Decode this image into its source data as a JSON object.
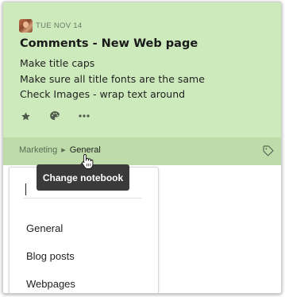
{
  "note": {
    "date": "TUE NOV 14",
    "title": "Comments - New Web page",
    "lines": [
      "Make title caps",
      "Make sure all title fonts are the same",
      "Check Images - wrap text around"
    ],
    "actions": [
      "star-icon",
      "palette-icon",
      "more-icon"
    ]
  },
  "footer": {
    "breadcrumb_parent": "Marketing",
    "breadcrumb_current": "General",
    "tag_icon": "tag-icon"
  },
  "tooltip": {
    "text": "Change notebook"
  },
  "notebook_picker": {
    "search_value": "",
    "items": [
      "General",
      "Blog posts",
      "Webpages"
    ]
  },
  "colors": {
    "card_bg": "#cdeabc",
    "footer_bg": "#bedca9",
    "tooltip_bg": "#3a3a3a"
  }
}
